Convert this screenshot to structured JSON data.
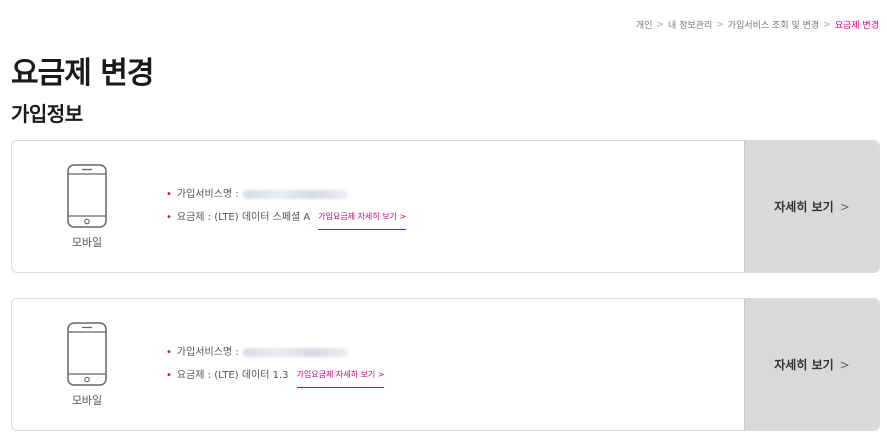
{
  "breadcrumb": {
    "items": [
      "개인",
      "내 정보관리",
      "가입서비스 조회 및 변경"
    ],
    "current": "요금제 변경",
    "separator": ">"
  },
  "page_title": "요금제 변경",
  "section_title": "가입정보",
  "cards": [
    {
      "device_label": "모바일",
      "service_name_label": "가입서비스명 :",
      "plan_label": "요금제 : (LTE) 데이터 스페셜 A",
      "plan_link": "가입요금제 자세히 보기 >",
      "detail_button": "자세히 보기",
      "detail_chevron": ">"
    },
    {
      "device_label": "모바일",
      "service_name_label": "가입서비스명 :",
      "plan_label": "요금제 : (LTE) 데이터 1.3",
      "plan_link": "가입요금제 자세히 보기 >",
      "detail_button": "자세히 보기",
      "detail_chevron": ">"
    }
  ],
  "colors": {
    "accent": "#e4007f",
    "detail_button_bg": "#d9d9d9"
  }
}
